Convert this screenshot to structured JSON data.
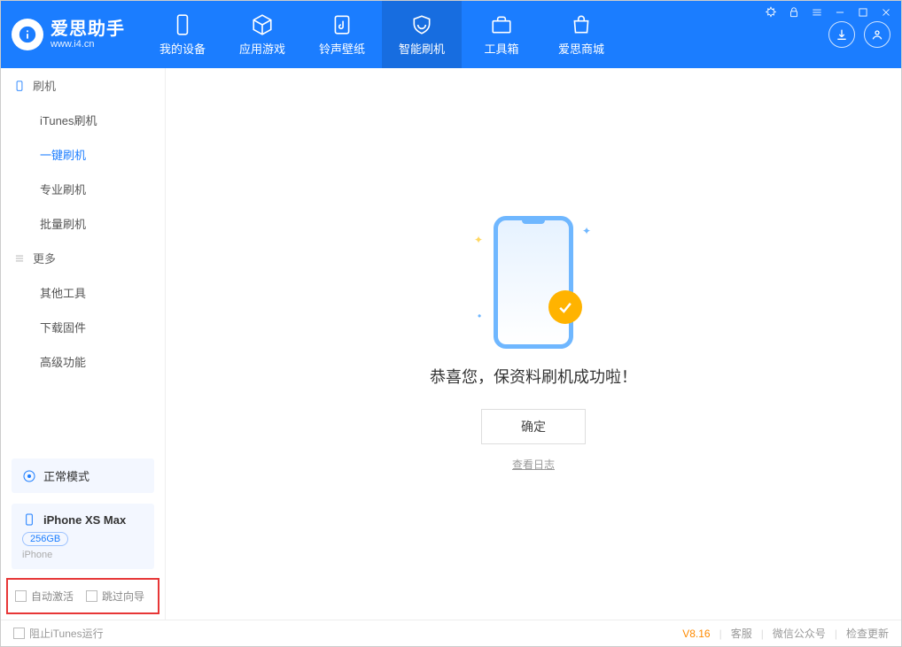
{
  "app": {
    "title": "爱思助手",
    "url": "www.i4.cn"
  },
  "nav": {
    "tabs": [
      {
        "label": "我的设备"
      },
      {
        "label": "应用游戏"
      },
      {
        "label": "铃声壁纸"
      },
      {
        "label": "智能刷机"
      },
      {
        "label": "工具箱"
      },
      {
        "label": "爱思商城"
      }
    ]
  },
  "sidebar": {
    "groups": [
      {
        "title": "刷机",
        "items": [
          {
            "label": "iTunes刷机"
          },
          {
            "label": "一键刷机",
            "active": true
          },
          {
            "label": "专业刷机"
          },
          {
            "label": "批量刷机"
          }
        ]
      },
      {
        "title": "更多",
        "items": [
          {
            "label": "其他工具"
          },
          {
            "label": "下载固件"
          },
          {
            "label": "高级功能"
          }
        ]
      }
    ],
    "mode": "正常模式",
    "device": {
      "name": "iPhone XS Max",
      "capacity": "256GB",
      "type": "iPhone"
    },
    "checks": {
      "auto_activate": "自动激活",
      "skip_guide": "跳过向导"
    }
  },
  "main": {
    "success": "恭喜您，保资料刷机成功啦！",
    "ok": "确定",
    "view_log": "查看日志"
  },
  "footer": {
    "block_itunes": "阻止iTunes运行",
    "version": "V8.16",
    "links": {
      "support": "客服",
      "wechat": "微信公众号",
      "update": "检查更新"
    }
  }
}
